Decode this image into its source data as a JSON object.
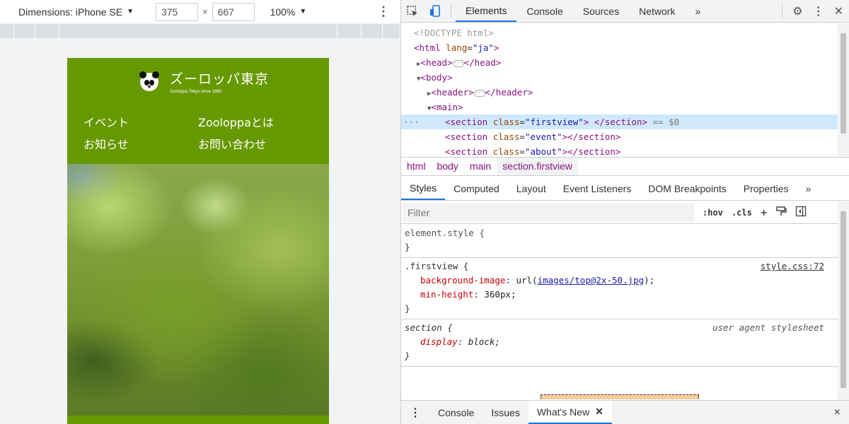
{
  "device_toolbar": {
    "device_label": "Dimensions: iPhone SE",
    "width": "375",
    "times": "×",
    "height": "667",
    "zoom": "100%"
  },
  "site": {
    "logo_title": "ズーロッパ東京",
    "logo_subtitle": "Zooloppa Tokyo since 1969",
    "nav": [
      "イベント",
      "Zooloppaとは",
      "お知らせ",
      "お問い合わせ"
    ],
    "header_color": "#669900"
  },
  "devtools": {
    "tabs": [
      "Elements",
      "Console",
      "Sources",
      "Network"
    ],
    "more": "»",
    "dom": {
      "doctype": "<!DOCTYPE html>",
      "html_open": "html",
      "html_attr_name": "lang",
      "html_attr_value": "\"ja\"",
      "head": "head",
      "body": "body",
      "header": "header",
      "main": "main",
      "section": "section",
      "class_attr": "class",
      "firstview_class": "\"firstview\"",
      "event_class": "\"event\"",
      "about_class": "\"about\"",
      "selected_suffix": "== $0",
      "gutter_dots": "···"
    },
    "breadcrumbs": [
      "html",
      "body",
      "main",
      "section.firstview"
    ],
    "sub_tabs": [
      "Styles",
      "Computed",
      "Layout",
      "Event Listeners",
      "DOM Breakpoints",
      "Properties"
    ],
    "filter_placeholder": "Filter",
    "hov": ":hov",
    "cls": ".cls",
    "rules": {
      "element_style": "element.style {",
      "close_brace": "}",
      "firstview_selector": ".firstview {",
      "firstview_source": "style.css:72",
      "bg_prop": "background-image",
      "bg_url_prefix": "url(",
      "bg_url": "images/top@2x-50.jpg",
      "bg_url_suffix": ");",
      "minh_prop": "min-height",
      "minh_value": "360px;",
      "section_selector": "section {",
      "section_source": "user agent stylesheet",
      "display_prop": "display",
      "display_value": "block;"
    },
    "drawer_tabs": [
      "Console",
      "Issues",
      "What's New"
    ],
    "drawer_close": "×"
  }
}
